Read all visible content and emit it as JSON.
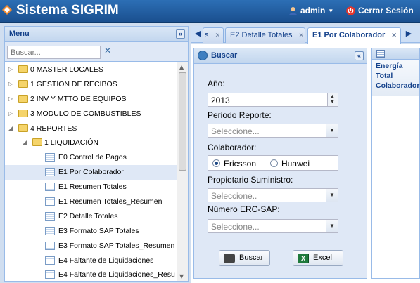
{
  "header": {
    "title": "Sistema SIGRIM",
    "user": "admin",
    "logout_label": "Cerrar Sesión",
    "colors": {
      "bar": "#1f5a9c",
      "accent": "#e6342a"
    }
  },
  "menu": {
    "title": "Menu",
    "search_placeholder": "Buscar...",
    "items": [
      {
        "label": "0 MASTER LOCALES",
        "type": "folder",
        "expanded": false
      },
      {
        "label": "1 GESTION DE RECIBOS",
        "type": "folder",
        "expanded": false
      },
      {
        "label": "2 INV Y MTTO DE EQUIPOS",
        "type": "folder",
        "expanded": false
      },
      {
        "label": "3 MODULO DE COMBUSTIBLES",
        "type": "folder",
        "expanded": false
      },
      {
        "label": "4 REPORTES",
        "type": "folder",
        "expanded": true
      },
      {
        "label": "1 LIQUIDACIÓN",
        "type": "folder",
        "expanded": true
      },
      {
        "label": "E0 Control de Pagos",
        "type": "leaf"
      },
      {
        "label": "E1 Por Colaborador",
        "type": "leaf",
        "selected": true
      },
      {
        "label": "E1 Resumen Totales",
        "type": "leaf"
      },
      {
        "label": "E1 Resumen Totales_Resumen",
        "type": "leaf"
      },
      {
        "label": "E2 Detalle Totales",
        "type": "leaf"
      },
      {
        "label": "E3 Formato SAP Totales",
        "type": "leaf"
      },
      {
        "label": "E3 Formato SAP Totales_Resumen",
        "type": "leaf"
      },
      {
        "label": "E4 Faltante de Liquidaciones",
        "type": "leaf"
      },
      {
        "label": "E4 Faltante de Liquidaciones_Resu",
        "type": "leaf"
      }
    ]
  },
  "tabs": [
    {
      "label": "s",
      "active": false
    },
    {
      "label": "E2 Detalle Totales",
      "active": false
    },
    {
      "label": "E1 Por Colaborador",
      "active": true
    }
  ],
  "search_panel": {
    "title": "Buscar",
    "fields": {
      "year_label": "Año:",
      "year_value": "2013",
      "periodo_label": "Periodo Reporte:",
      "periodo_placeholder": "Seleccione...",
      "colaborador_label": "Colaborador:",
      "colaborador_options": [
        "Ericsson",
        "Huawei"
      ],
      "colaborador_selected": "Ericsson",
      "propietario_label": "Propietario Suministro:",
      "propietario_placeholder": "Seleccione..",
      "erc_label": "Número ERC-SAP:",
      "erc_placeholder": "Seleccione..."
    },
    "buttons": {
      "search": "Buscar",
      "excel": "Excel"
    }
  },
  "grid": {
    "column_header": "Energía Total Colaborador"
  }
}
